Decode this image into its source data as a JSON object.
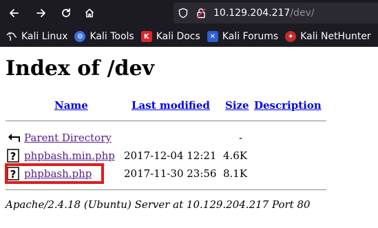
{
  "browser": {
    "url_host": "10.129.204.217",
    "url_path": "/dev/"
  },
  "bookmarks": [
    {
      "label": "Kali Linux",
      "icon": "kali-linux-icon"
    },
    {
      "label": "Kali Tools",
      "icon": "kali-tools-icon"
    },
    {
      "label": "Kali Docs",
      "icon": "kali-docs-icon"
    },
    {
      "label": "Kali Forums",
      "icon": "kali-forums-icon"
    },
    {
      "label": "Kali NetHunter",
      "icon": "kali-nethunter-icon"
    }
  ],
  "page": {
    "title": "Index of /dev",
    "headers": {
      "name": "Name",
      "last_modified": "Last modified",
      "size": "Size",
      "description": "Description"
    },
    "rows": [
      {
        "name": "Parent Directory",
        "date": "",
        "size": "-",
        "icon": "back-arrow-icon"
      },
      {
        "name": "phpbash.min.php",
        "date": "2017-12-04 12:21",
        "size": "4.6K",
        "icon": "unknown-file-icon"
      },
      {
        "name": "phpbash.php",
        "date": "2017-11-30 23:56",
        "size": "8.1K",
        "icon": "unknown-file-icon"
      }
    ],
    "footer": "Apache/2.4.18 (Ubuntu) Server at 10.129.204.217 Port 80"
  },
  "colors": {
    "highlight_box": "#e11b1b",
    "link": "#0000ee",
    "visited_link": "#551a8b",
    "chrome_bg": "#1c1b22"
  }
}
